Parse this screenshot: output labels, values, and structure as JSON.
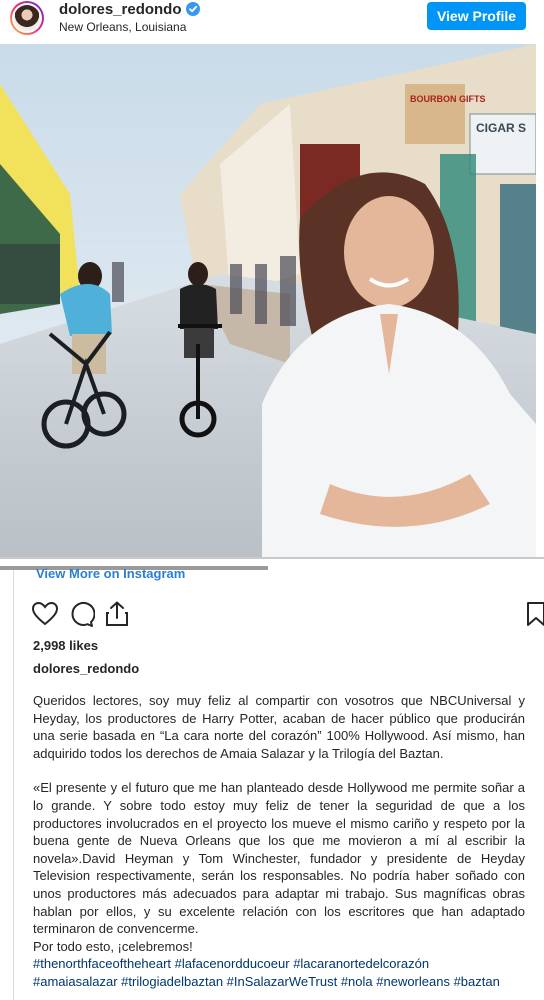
{
  "header": {
    "username": "dolores_redondo",
    "location": "New Orleans, Louisiana",
    "view_profile": "View Profile"
  },
  "photo": {
    "signs": [
      "BOURBON GIFTS",
      "CIGAR S"
    ]
  },
  "view_more": "View More on Instagram",
  "likes": "2,998 likes",
  "caption": {
    "username": "dolores_redondo",
    "paragraph1": "Queridos lectores, soy muy feliz al compartir con vosotros que NBCUniversal y Heyday, los productores de Harry Potter, acaban de hacer público que producirán una serie basada en “La cara norte del corazón” 100% Hollywood. Así mismo, han adquirido todos los derechos de Amaia Salazar y la Trilogía del Baztan.",
    "paragraph2": "«El presente y el futuro que me han planteado desde Hollywood me permite soñar a lo grande. Y sobre todo estoy muy feliz de tener la seguridad de que a los productores involucrados en el proyecto los mueve el mismo cariño y respeto por la buena gente de Nueva Orleans que los que me movieron a mí al escribir la novela».David Heyman y Tom Winchester, fundador y presidente de Heyday Television respectivamente, serán los responsables. No podría haber soñado con unos productores más adecuados para adaptar mi trabajo. Sus magníficas obras hablan por ellos, y su excelente relación con los escritores que han adaptado terminaron de convencerme.",
    "closing": "Por todo esto, ¡celebremos!",
    "hashtags1": "#thenorthfaceoftheheart #lafacenordducoeur #lacaranortedelcorazón",
    "hashtags2": "#amaiasalazar #trilogiadelbaztan #InSalazarWeTrust #nola #neworleans #baztan"
  },
  "colors": {
    "accent": "#0095f6",
    "link": "#00376b"
  },
  "icons": [
    "verified-badge-icon",
    "heart-icon",
    "comment-icon",
    "share-icon",
    "bookmark-icon"
  ]
}
